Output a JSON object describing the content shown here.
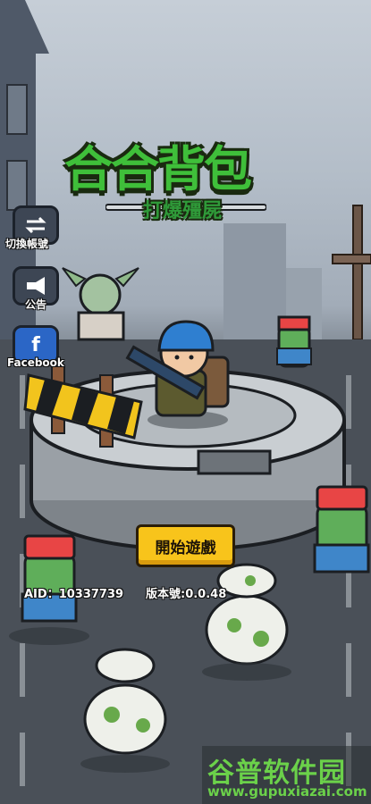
{
  "game": {
    "title": "合合背包",
    "subtitle": "打爆殭屍"
  },
  "side_menu": {
    "switch_account_label": "切換帳號",
    "notice_label": "公告",
    "facebook_label": "Facebook"
  },
  "start_button_label": "開始遊戲",
  "info": {
    "aid": "AID：10337739",
    "version": "版本號:0.0.48"
  },
  "watermark": {
    "name": "谷普软件园",
    "url": "www.gupuxiazai.com"
  },
  "colors": {
    "title_green": "#3fbf3a",
    "button_yellow": "#f8c41b",
    "watermark_green": "#6bd14a"
  }
}
